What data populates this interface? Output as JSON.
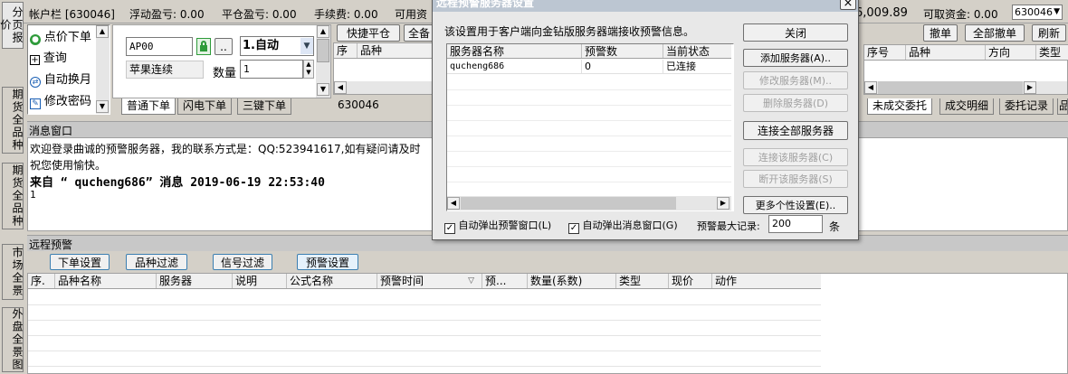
{
  "account_bar": {
    "account": "帐户栏 [630046]",
    "float_pl": "浮动盈亏: 0.00",
    "close_pl": "平仓盈亏: 0.00",
    "fee": "手续费: 0.00",
    "available": "可用资",
    "equity_tail": "6,009.89",
    "withdrawable": "可取资金: 0.00",
    "account_select": "630046"
  },
  "left_vtabs": [
    "分页报价",
    "期货全品种",
    "期货全品种",
    "市场全景",
    "外盘全景图"
  ],
  "left_menu": [
    {
      "icon": "order-icon",
      "label": "点价下单"
    },
    {
      "icon": "plus-box-icon",
      "label": "查询"
    },
    {
      "icon": "swap-icon",
      "label": "自动换月"
    },
    {
      "icon": "edit-icon",
      "label": "修改密码"
    }
  ],
  "order_panel": {
    "contract": "AP00",
    "dots": "..",
    "mode": "1.自动",
    "contract_name": "苹果连续",
    "qty_label": "数量",
    "qty": "1",
    "tabs": [
      "普通下单",
      "闪电下单",
      "三键下单"
    ]
  },
  "positions": {
    "quick_close": "快捷平仓",
    "all_prefix": "全备",
    "cols": [
      "序",
      "品种"
    ],
    "account_tab": "630046"
  },
  "orders_panel": {
    "cancel": "撤单",
    "cancel_all": "全部撤单",
    "refresh": "刷新",
    "cols": [
      "序号",
      "品种",
      "方向",
      "类型"
    ],
    "tabs": [
      "未成交委托",
      "成交明细",
      "委托记录",
      "品"
    ]
  },
  "message_window": {
    "title": "消息窗口",
    "line1": "欢迎登录曲诚的预警服务器，我的联系方式是：QQ:523941617,如有疑问请及时",
    "line2": "祝您使用愉快。",
    "line3": "来自 “ qucheng686” 消息 2019-06-19 22:53:40",
    "line4": "1"
  },
  "remote_alert": {
    "title": "远程预警",
    "buttons": [
      "下单设置",
      "品种过滤",
      "信号过滤",
      "预警设置"
    ],
    "cols": [
      "序.",
      "品种名称",
      "服务器",
      "说明",
      "公式名称",
      "预警时间",
      "预...",
      "数量(系数)",
      "类型",
      "现价",
      "动作"
    ]
  },
  "dialog": {
    "title": "远程预警服务器设置",
    "desc": "该设置用于客户端向金钻版服务器端接收预警信息。",
    "cols": [
      "服务器名称",
      "预警数",
      "当前状态"
    ],
    "rows": [
      {
        "name": "qucheng686",
        "count": "0",
        "status": "已连接"
      }
    ],
    "buttons": {
      "close": "关闭",
      "add": "添加服务器(A)..",
      "modify": "修改服务器(M)..",
      "delete": "删除服务器(D)",
      "connect_all": "连接全部服务器",
      "connect": "连接该服务器(C)",
      "disconnect": "断开该服务器(S)",
      "more": "更多个性设置(E).."
    },
    "auto_popup_alert": "自动弹出预警窗口(L)",
    "auto_popup_msg": "自动弹出消息窗口(G)",
    "max_records_label": "预警最大记录:",
    "max_records": "200",
    "unit": "条",
    "close_x": "×"
  }
}
